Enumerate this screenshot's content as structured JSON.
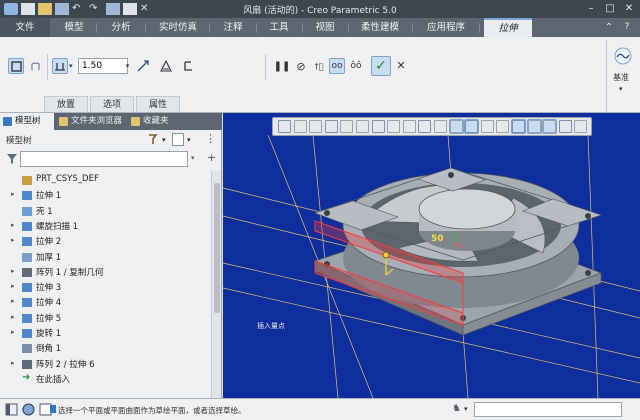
{
  "window": {
    "title": "风扇 (活动的) - Creo Parametric 5.0"
  },
  "ribbon": {
    "tabs": [
      "文件",
      "模型",
      "分析",
      "实时仿真",
      "注释",
      "工具",
      "视图",
      "柔性建模",
      "应用程序",
      "拉伸"
    ],
    "active_tab": "拉伸",
    "depth_value": "1.50",
    "subtabs": [
      "放置",
      "选项",
      "属性"
    ],
    "base_label": "基准"
  },
  "panel": {
    "tabs": [
      "模型树",
      "文件夹浏览器",
      "收藏夹"
    ],
    "tree_header": "模型树",
    "items": [
      {
        "label": "PRT_CSYS_DEF",
        "expandable": false,
        "icon": "csys-icon"
      },
      {
        "label": "拉伸 1",
        "expandable": true,
        "icon": "extrude-icon"
      },
      {
        "label": "壳 1",
        "expandable": false,
        "icon": "shell-icon"
      },
      {
        "label": "螺旋扫描 1",
        "expandable": true,
        "icon": "helical-sweep-icon"
      },
      {
        "label": "拉伸 2",
        "expandable": true,
        "icon": "extrude-icon"
      },
      {
        "label": "加厚 1",
        "expandable": false,
        "icon": "thicken-icon"
      },
      {
        "label": "阵列 1 / 复制几何",
        "expandable": true,
        "icon": "pattern-icon"
      },
      {
        "label": "拉伸 3",
        "expandable": true,
        "icon": "extrude-icon"
      },
      {
        "label": "拉伸 4",
        "expandable": true,
        "icon": "extrude-icon"
      },
      {
        "label": "拉伸 5",
        "expandable": true,
        "icon": "extrude-icon"
      },
      {
        "label": "旋转 1",
        "expandable": true,
        "icon": "revolve-icon"
      },
      {
        "label": "倒角 1",
        "expandable": false,
        "icon": "chamfer-icon"
      },
      {
        "label": "阵列 2 / 拉伸 6",
        "expandable": true,
        "icon": "pattern-icon"
      },
      {
        "label": "在此插入",
        "expandable": false,
        "icon": "insert-here-icon"
      }
    ]
  },
  "viewport": {
    "dimension_value": "50",
    "note_text": "插入量点"
  },
  "status": {
    "message": "选择一个平面或平面曲面作为草绘平面，或者选择草绘。"
  },
  "colors": {
    "viewport_bg": "#0d2e9c",
    "accent": "#7aa3cf",
    "ok_green": "#168a3c",
    "ribbon_dark": "#5b6670"
  }
}
